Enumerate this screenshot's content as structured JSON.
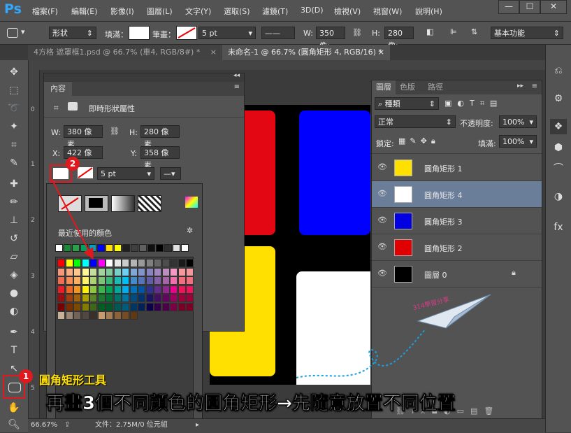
{
  "app": {
    "logo": "Ps"
  },
  "menu": [
    "檔案(F)",
    "編輯(E)",
    "影像(I)",
    "圖層(L)",
    "文字(Y)",
    "選取(S)",
    "濾鏡(T)",
    "3D(D)",
    "檢視(V)",
    "視窗(W)",
    "說明(H)"
  ],
  "window_controls": [
    "—",
    "☐",
    "✕"
  ],
  "options": {
    "mode": "形狀",
    "fill_label": "填滿：",
    "stroke_label": "筆畫：",
    "stroke_size": "5 pt",
    "w_label": "W:",
    "w_value": "350 像:",
    "h_label": "H:",
    "h_value": "280 像:",
    "workspace": "基本功能"
  },
  "tabs": [
    {
      "label": "4方格 遮罩框1.psd @ 66.7% (車4, RGB/8#) *",
      "close": "×"
    },
    {
      "label": "未命名-1 @ 66.7% (圓角矩形 4, RGB/16) *",
      "close": "×"
    }
  ],
  "properties": {
    "tab": "內容",
    "header": "即時形狀屬性",
    "w_label": "W:",
    "w_value": "380 像素",
    "h_label": "H:",
    "h_value": "280 像素",
    "x_label": "X:",
    "x_value": "422 像素",
    "y_label": "Y:",
    "y_value": "358 像素",
    "stroke_size": "5 pt"
  },
  "swatches": {
    "recent_label": "最近使用的顏色",
    "recent": [
      "#ffffff",
      "#1a8a3a",
      "#29a04a",
      "#00a060",
      "#00a0c0",
      "#0000ff",
      "#ffe000",
      "#ffff00",
      "#202020",
      "#404040",
      "#606060",
      "#101010",
      "#000000",
      "#303030",
      "#e0e0e0",
      "#ffffff"
    ],
    "grid": [
      [
        "#ff0000",
        "#ffff00",
        "#00ff00",
        "#00ffff",
        "#0000ff",
        "#ff00ff",
        "#ffffff",
        "#e6e6e6",
        "#cccccc",
        "#b3b3b3",
        "#999999",
        "#808080",
        "#666666",
        "#4d4d4d",
        "#333333",
        "#1a1a1a",
        "#000000"
      ],
      [
        "#f7977a",
        "#f9ad81",
        "#fdc68a",
        "#fff79a",
        "#c4df9b",
        "#a2d39c",
        "#82ca9d",
        "#7bcdc8",
        "#6ecff6",
        "#7ea7d8",
        "#8493ca",
        "#8882be",
        "#a187be",
        "#bc8dbf",
        "#f49ac2",
        "#f6989d",
        "#f5989d"
      ],
      [
        "#f26c4f",
        "#f68e55",
        "#fbaf5c",
        "#fff467",
        "#acd372",
        "#7cc576",
        "#3bb878",
        "#1abbb4",
        "#00bff3",
        "#438ccb",
        "#5574b9",
        "#605ca8",
        "#855fa8",
        "#a763a8",
        "#f06ea9",
        "#f26d7d",
        "#f26d7d"
      ],
      [
        "#ed1c24",
        "#f26522",
        "#f7941d",
        "#fff200",
        "#8dc73f",
        "#39b54a",
        "#00a651",
        "#00a99d",
        "#00aeef",
        "#0072bc",
        "#0054a6",
        "#2e3192",
        "#662d91",
        "#92278f",
        "#ec008c",
        "#ed145b",
        "#ed145b"
      ],
      [
        "#9e0b0f",
        "#a0410d",
        "#a36209",
        "#aba000",
        "#598527",
        "#1a7b30",
        "#007236",
        "#00746b",
        "#0076a3",
        "#004b80",
        "#003471",
        "#1b1464",
        "#440e62",
        "#630460",
        "#9e005d",
        "#9e0039",
        "#9e0039"
      ],
      [
        "#790000",
        "#7b2e00",
        "#7d4900",
        "#827b00",
        "#406618",
        "#005e20",
        "#005826",
        "#005952",
        "#005b7f",
        "#003663",
        "#002157",
        "#0d004c",
        "#32004b",
        "#4b0049",
        "#7b0046",
        "#7a0026",
        "#7a0026"
      ],
      [
        "#c7b299",
        "#998675",
        "#736357",
        "#534741",
        "#37302d",
        "#c69c6d",
        "#a67c52",
        "#8c6239",
        "#754c24",
        "#603913"
      ]
    ]
  },
  "layers": {
    "tabs": [
      "圖層",
      "色版",
      "路徑"
    ],
    "filter": "種類",
    "blend": "正常",
    "opacity_label": "不透明度:",
    "opacity": "100%",
    "lock_label": "鎖定:",
    "fill_label": "填滿:",
    "fill": "100%",
    "items": [
      {
        "name": "圓角矩形 1",
        "color": "#ffe000"
      },
      {
        "name": "圓角矩形 4",
        "color": "#ffffff"
      },
      {
        "name": "圓角矩形 3",
        "color": "#0000e0"
      },
      {
        "name": "圓角矩形 2",
        "color": "#e00000"
      },
      {
        "name": "圖層 0",
        "color": "#000000"
      }
    ]
  },
  "status": {
    "zoom": "66.67%",
    "doc": "文件：2.75M/0 位元組"
  },
  "annotations": {
    "badge1": "1",
    "badge2": "2",
    "tool_label": "圓角矩形工具",
    "caption": "再畫3個不同顏色的圓角矩形→先隨意放置不同位置",
    "watermark": "314學習分享"
  },
  "colors": {
    "red": "#e30613",
    "blue": "#0000ff",
    "yellow": "#ffe000",
    "highlight": "#e0191e"
  }
}
